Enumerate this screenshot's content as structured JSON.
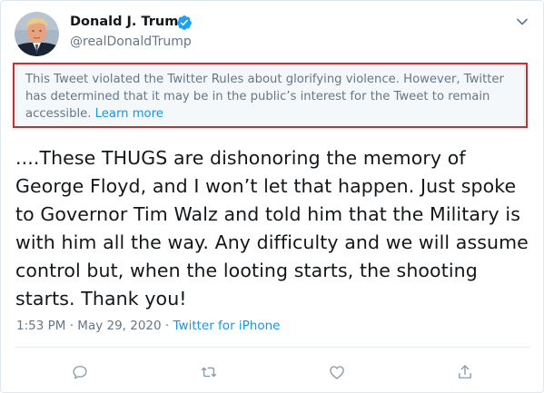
{
  "author": {
    "name": "Donald J. Trump",
    "handle": "@realDonaldTrump",
    "avatar_icon": "profile-photo",
    "verified_icon": "verified-badge-icon"
  },
  "notice": {
    "text": "This Tweet violated the Twitter Rules about glorifying violence. However, Twitter has determined that it may be in the public’s interest for the Tweet to remain accessible.",
    "link_label": "Learn more"
  },
  "tweet": {
    "text": "....These THUGS are dishonoring the memory of George Floyd, and I won’t let that happen. Just spoke to Governor Tim Walz and told him that the Military is with him all the way. Any difficulty and we will assume control but, when the looting starts, the shooting starts. Thank you!"
  },
  "meta": {
    "time": "1:53 PM",
    "separator": "·",
    "date": "May 29, 2020",
    "source": "Twitter for iPhone"
  },
  "actions": [
    "reply-icon",
    "retweet-icon",
    "like-icon",
    "share-icon"
  ],
  "colors": {
    "link": "#1b95e0",
    "verified": "#1da1f2",
    "muted": "#657786",
    "highlight": "#d9262b"
  }
}
